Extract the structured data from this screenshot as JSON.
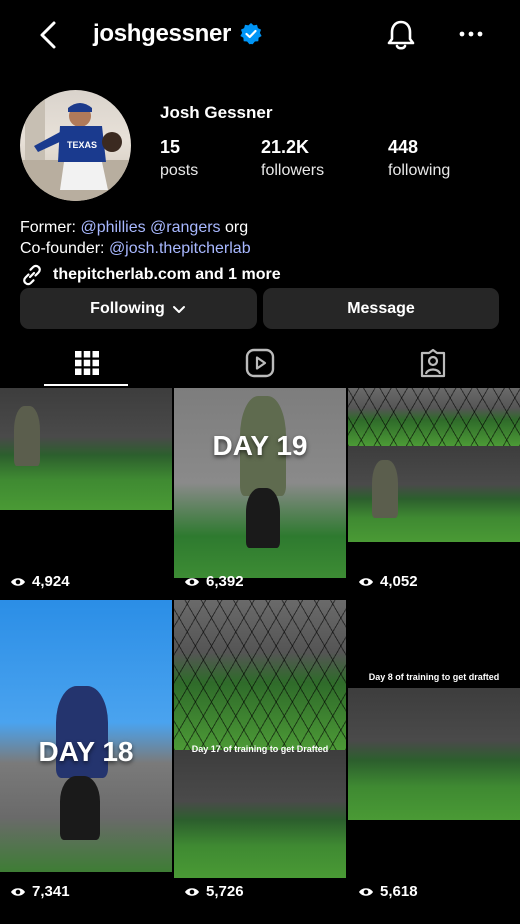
{
  "header": {
    "username": "joshgessner",
    "icons": {
      "back": "chevron-left-icon",
      "verified": "verified-badge-icon",
      "notifications": "bell-icon",
      "more": "more-horizontal-icon"
    },
    "accent": "#0095f6"
  },
  "profile": {
    "display_name": "Josh Gessner",
    "stats": [
      {
        "value": "15",
        "label": "posts"
      },
      {
        "value": "21.2K",
        "label": "followers"
      },
      {
        "value": "448",
        "label": "following"
      }
    ],
    "bio": {
      "line1_prefix": "Former: ",
      "line1_mentions": "@phillies @rangers",
      "line1_suffix": " org",
      "line2_prefix": "Co-founder: ",
      "line2_mention": "@josh.thepitcherlab"
    },
    "link_text": "thepitcherlab.com and 1 more",
    "mention_color": "#a8b8ff"
  },
  "actions": {
    "following_label": "Following",
    "message_label": "Message"
  },
  "tabs": [
    {
      "name": "posts-grid",
      "icon": "grid-icon",
      "active": true
    },
    {
      "name": "reels",
      "icon": "reels-icon",
      "active": false
    },
    {
      "name": "tagged",
      "icon": "tagged-user-icon",
      "active": false
    }
  ],
  "posts": [
    {
      "views": "4,924",
      "caption": ""
    },
    {
      "views": "6,392",
      "caption": "DAY 19"
    },
    {
      "views": "4,052",
      "caption": ""
    },
    {
      "views": "7,341",
      "caption": "DAY 18"
    },
    {
      "views": "5,726",
      "caption": "Day 17 of training to get Drafted"
    },
    {
      "views": "5,618",
      "caption": "Day 8 of training to get drafted"
    }
  ]
}
